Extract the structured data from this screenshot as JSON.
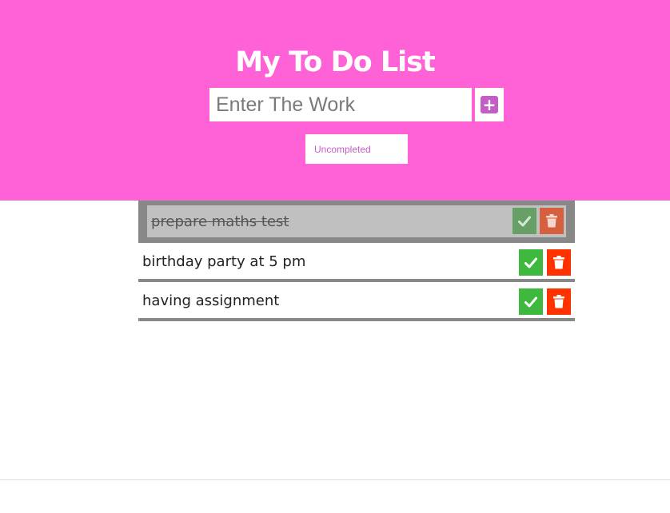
{
  "header": {
    "title": "My To Do List",
    "input_placeholder": "Enter The Work",
    "input_value": "",
    "add_icon": "+",
    "filter_selected": "Uncompleted",
    "background_color": "#ff62d6",
    "accent_color": "#c35fc4"
  },
  "todos": [
    {
      "text": "prepare maths test",
      "completed": true
    },
    {
      "text": "birthday party at 5 pm",
      "completed": false
    },
    {
      "text": "having assignment",
      "completed": false
    }
  ],
  "icons": {
    "check": "check-icon",
    "trash": "trash-icon",
    "add": "plus-square-icon"
  },
  "colors": {
    "check_button": "#3fb83f",
    "trash_button": "#ff3300"
  }
}
